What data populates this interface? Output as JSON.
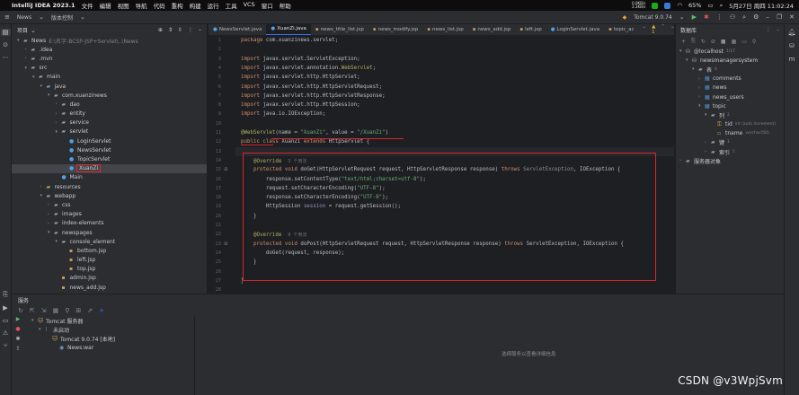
{
  "menubar": {
    "app_name": "IntelliJ IDEA 2023.1",
    "menus": [
      "文件",
      "编辑",
      "视图",
      "导航",
      "代码",
      "重构",
      "构建",
      "运行",
      "工具",
      "VCS",
      "窗口",
      "帮助"
    ],
    "net_up": "0.0KB/s",
    "net_down": "2.2KB/s",
    "battery": "65%",
    "datetime": "5月27日 周四 11:02:24"
  },
  "toolbar": {
    "project_name": "News",
    "vcs_label": "版本控制",
    "run_config": "Tomcat 9.0.74"
  },
  "project": {
    "title": "项目",
    "items": [
      {
        "depth": 0,
        "arrow": "▾",
        "icon": "folder",
        "label": "News",
        "path": "E:\\名字-BCSP-JSP+Servlet\\..\\News"
      },
      {
        "depth": 1,
        "arrow": "›",
        "icon": "folder",
        "label": ".idea"
      },
      {
        "depth": 1,
        "arrow": "›",
        "icon": "folder",
        "label": ".mvn"
      },
      {
        "depth": 1,
        "arrow": "▾",
        "icon": "folder",
        "label": "src"
      },
      {
        "depth": 2,
        "arrow": "▾",
        "icon": "folder",
        "label": "main"
      },
      {
        "depth": 3,
        "arrow": "▾",
        "icon": "src",
        "label": "java"
      },
      {
        "depth": 4,
        "arrow": "▾",
        "icon": "folder",
        "label": "com.xuanzinews"
      },
      {
        "depth": 5,
        "arrow": "›",
        "icon": "folder",
        "label": "dao"
      },
      {
        "depth": 5,
        "arrow": "›",
        "icon": "folder",
        "label": "entity"
      },
      {
        "depth": 5,
        "arrow": "›",
        "icon": "folder",
        "label": "service"
      },
      {
        "depth": 5,
        "arrow": "▾",
        "icon": "folder",
        "label": "servlet"
      },
      {
        "depth": 6,
        "arrow": "",
        "icon": "class",
        "label": "LoginServlet"
      },
      {
        "depth": 6,
        "arrow": "",
        "icon": "class",
        "label": "NewsServlet"
      },
      {
        "depth": 6,
        "arrow": "",
        "icon": "class",
        "label": "TopicServlet"
      },
      {
        "depth": 6,
        "arrow": "",
        "icon": "class",
        "label": "XuanZi",
        "selected": true
      },
      {
        "depth": 5,
        "arrow": "",
        "icon": "class",
        "label": "Main"
      },
      {
        "depth": 3,
        "arrow": "›",
        "icon": "res",
        "label": "resources"
      },
      {
        "depth": 3,
        "arrow": "▾",
        "icon": "folder",
        "label": "webapp"
      },
      {
        "depth": 4,
        "arrow": "›",
        "icon": "folder",
        "label": "css"
      },
      {
        "depth": 4,
        "arrow": "›",
        "icon": "folder",
        "label": "images"
      },
      {
        "depth": 4,
        "arrow": "›",
        "icon": "folder",
        "label": "index-elements"
      },
      {
        "depth": 4,
        "arrow": "▾",
        "icon": "folder",
        "label": "newspages"
      },
      {
        "depth": 5,
        "arrow": "▾",
        "icon": "folder",
        "label": "console_element"
      },
      {
        "depth": 6,
        "arrow": "",
        "icon": "file",
        "label": "bottom.jsp"
      },
      {
        "depth": 6,
        "arrow": "",
        "icon": "file",
        "label": "left.jsp"
      },
      {
        "depth": 6,
        "arrow": "",
        "icon": "file",
        "label": "top.jsp"
      },
      {
        "depth": 5,
        "arrow": "",
        "icon": "file",
        "label": "admin.jsp"
      },
      {
        "depth": 5,
        "arrow": "",
        "icon": "file",
        "label": "news_add.jsp"
      }
    ]
  },
  "editor": {
    "tabs": [
      {
        "label": "NewsServlet.java",
        "java": true
      },
      {
        "label": "XuanZi.java",
        "java": true,
        "active": true
      },
      {
        "label": "news_title_list.jsp"
      },
      {
        "label": "news_modify.jsp"
      },
      {
        "label": "news_list.jsp"
      },
      {
        "label": "news_add.jsp"
      },
      {
        "label": "left.jsp"
      },
      {
        "label": "LoginServlet.java",
        "java": true
      },
      {
        "label": "topic_ac"
      }
    ],
    "warnings": "▲ 1",
    "lines": [
      {
        "n": "1",
        "html": "<span class='kw'>package</span> com.xuanzinews.servlet;"
      },
      {
        "n": "2",
        "html": ""
      },
      {
        "n": "3",
        "html": "<span class='kw'>import</span> javax.servlet.ServletException;"
      },
      {
        "n": "4",
        "html": "<span class='kw'>import</span> javax.servlet.annotation.<span class='ann'>WebServlet</span>;"
      },
      {
        "n": "5",
        "html": "<span class='kw'>import</span> javax.servlet.http.HttpServlet;"
      },
      {
        "n": "6",
        "html": "<span class='kw'>import</span> javax.servlet.http.HttpServletRequest;"
      },
      {
        "n": "7",
        "html": "<span class='kw'>import</span> javax.servlet.http.HttpServletResponse;"
      },
      {
        "n": "8",
        "html": "<span class='kw'>import</span> javax.servlet.http.HttpSession;"
      },
      {
        "n": "9",
        "html": "<span class='kw'>import</span> java.io.IOException;"
      },
      {
        "n": "10",
        "html": ""
      },
      {
        "n": "11",
        "html": "<span class='ann'>@WebServlet</span>(name = <span class='str'>\"XuanZi\"</span>, value = <span class='str'>\"/XuanZi\"</span>)"
      },
      {
        "n": "12",
        "html": "<span class='kw'>public class</span> XuanZi <span class='kw'>extends</span> HttpServlet {"
      },
      {
        "n": "13",
        "html": ""
      },
      {
        "n": "14",
        "html": "    <span class='ann'>@Override</span>  <span class='hint'>3 个用法</span>"
      },
      {
        "n": "15",
        "html": "    <span class='kw'>protected void</span> doGet(HttpServletRequest request, HttpServletResponse response) <span class='kw'>throws</span> <span class='muted'>ServletException</span>, IOException {"
      },
      {
        "n": "16",
        "html": "        response.setContentType(<span class='str'>\"text/html;charset=utf-8\"</span>);"
      },
      {
        "n": "17",
        "html": "        request.setCharacterEncoding(<span class='str'>\"UTF-8\"</span>);"
      },
      {
        "n": "18",
        "html": "        response.setCharacterEncoding(<span class='str'>\"UTF-8\"</span>);"
      },
      {
        "n": "19",
        "html": "        HttpSession <span class='param'>session</span> = request.getSession();"
      },
      {
        "n": "20",
        "html": "    }"
      },
      {
        "n": "21",
        "html": ""
      },
      {
        "n": "22",
        "html": "    <span class='ann'>@Override</span>  <span class='hint'>0 个用法</span>"
      },
      {
        "n": "23",
        "html": "    <span class='kw'>protected void</span> doPost(HttpServletRequest request, HttpServletResponse response) <span class='kw'>throws</span> ServletException, IOException {"
      },
      {
        "n": "24",
        "html": "        doGet(request, response);"
      },
      {
        "n": "25",
        "html": "    }"
      },
      {
        "n": "26",
        "html": ""
      },
      {
        "n": "27",
        "html": "}"
      },
      {
        "n": "28",
        "html": ""
      }
    ]
  },
  "database": {
    "title": "数据库",
    "items": [
      {
        "depth": 0,
        "arrow": "▾",
        "icon": "db",
        "label": "@localhost",
        "hint": "1/17"
      },
      {
        "depth": 1,
        "arrow": "▾",
        "icon": "db",
        "label": "newsmanagersystem"
      },
      {
        "depth": 2,
        "arrow": "▾",
        "icon": "folder",
        "label": "表",
        "hint": "4"
      },
      {
        "depth": 3,
        "arrow": "›",
        "icon": "tbl",
        "label": "comments"
      },
      {
        "depth": 3,
        "arrow": "›",
        "icon": "tbl",
        "label": "news"
      },
      {
        "depth": 3,
        "arrow": "›",
        "icon": "tbl",
        "label": "news_users"
      },
      {
        "depth": 3,
        "arrow": "▾",
        "icon": "tbl",
        "label": "topic"
      },
      {
        "depth": 4,
        "arrow": "▾",
        "icon": "folder",
        "label": "列",
        "hint": "2"
      },
      {
        "depth": 5,
        "arrow": "",
        "icon": "key",
        "label": "tid",
        "hint": "int (auto increment)"
      },
      {
        "depth": 5,
        "arrow": "",
        "icon": "col",
        "label": "tname",
        "hint": "varchar(50)"
      },
      {
        "depth": 4,
        "arrow": "›",
        "icon": "folder",
        "label": "键",
        "hint": "1"
      },
      {
        "depth": 4,
        "arrow": "›",
        "icon": "folder",
        "label": "索引",
        "hint": "1"
      },
      {
        "depth": 0,
        "arrow": "›",
        "icon": "folder",
        "label": "服务器对象"
      }
    ]
  },
  "services": {
    "title": "服务",
    "tree": [
      {
        "depth": 0,
        "arrow": "▾",
        "icon": "tomcat",
        "label": "Tomcat 服务器"
      },
      {
        "depth": 1,
        "arrow": "▾",
        "icon": "status",
        "label": "未启动"
      },
      {
        "depth": 2,
        "arrow": "",
        "icon": "tomcat",
        "label": "Tomcat 9.0.74 [本地]"
      },
      {
        "depth": 3,
        "arrow": "",
        "icon": "war",
        "label": "News:war"
      }
    ],
    "empty_hint": "选择服务以查看详细信息"
  },
  "watermark": "CSDN @v3WpjSvm",
  "colors": {
    "accent": "#3574f0",
    "highlight_red": "#d7242b"
  }
}
